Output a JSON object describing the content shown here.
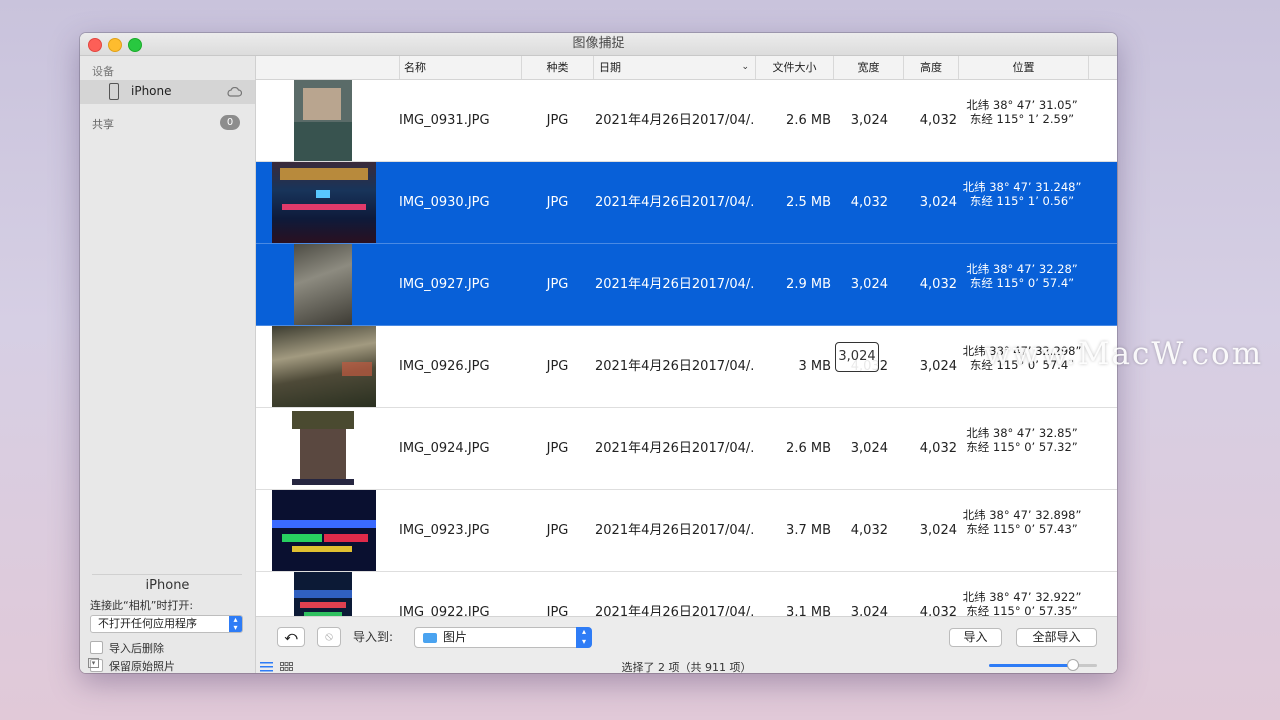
{
  "window": {
    "title": "图像捕捉"
  },
  "sidebar": {
    "devices_header": "设备",
    "device_name": "iPhone",
    "shared_header": "共享",
    "shared_count": "0",
    "device_section_title": "iPhone",
    "connect_label": "连接此“相机”时打开:",
    "open_app_value": "不打开任何应用程序",
    "delete_after_import": "导入后删除",
    "keep_originals": "保留原始照片"
  },
  "columns": {
    "name": "名称",
    "kind": "种类",
    "date": "日期",
    "size": "文件大小",
    "width": "宽度",
    "height": "高度",
    "location": "位置"
  },
  "rows": [
    {
      "name": "IMG_0931.JPG",
      "kind": "JPG",
      "date": "2021年4月26日2017/04/...",
      "size": "2.6 MB",
      "width": "3,024",
      "height": "4,032",
      "lat": "北纬 38° 47’ 31.05”",
      "lon": "东经 115° 1’ 2.59”",
      "selected": false
    },
    {
      "name": "IMG_0930.JPG",
      "kind": "JPG",
      "date": "2021年4月26日2017/04/...",
      "size": "2.5 MB",
      "width": "4,032",
      "height": "3,024",
      "lat": "北纬 38° 47’ 31.248”",
      "lon": "东经 115° 1’ 0.56”",
      "selected": true
    },
    {
      "name": "IMG_0927.JPG",
      "kind": "JPG",
      "date": "2021年4月26日2017/04/...",
      "size": "2.9 MB",
      "width": "3,024",
      "height": "4,032",
      "lat": "北纬 38° 47’ 32.28”",
      "lon": "东经 115° 0’ 57.4”",
      "selected": true
    },
    {
      "name": "IMG_0926.JPG",
      "kind": "JPG",
      "date": "2021年4月26日2017/04/...",
      "size": "3 MB",
      "width": "4,032",
      "height": "3,024",
      "lat": "北纬 38° 47’ 32.298”",
      "lon": "东经 115° 0’ 57.4”",
      "selected": false
    },
    {
      "name": "IMG_0924.JPG",
      "kind": "JPG",
      "date": "2021年4月26日2017/04/...",
      "size": "2.6 MB",
      "width": "3,024",
      "height": "4,032",
      "lat": "北纬 38° 47’ 32.85”",
      "lon": "东经 115° 0’ 57.32”",
      "selected": false
    },
    {
      "name": "IMG_0923.JPG",
      "kind": "JPG",
      "date": "2021年4月26日2017/04/...",
      "size": "3.7 MB",
      "width": "4,032",
      "height": "3,024",
      "lat": "北纬 38° 47’ 32.898”",
      "lon": "东经 115° 0’ 57.43”",
      "selected": false
    },
    {
      "name": "IMG_0922.JPG",
      "kind": "JPG",
      "date": "2021年4月26日2017/04/...",
      "size": "3.1 MB",
      "width": "3,024",
      "height": "4,032",
      "lat": "北纬 38° 47’ 32.922”",
      "lon": "东经 115° 0’ 57.35”",
      "selected": false
    }
  ],
  "footer": {
    "import_to_label": "导入到:",
    "destination": "图片",
    "import_button": "导入",
    "import_all_button": "全部导入",
    "status": "选择了 2 项（共 911 项）",
    "thumbnail_size": 0.78
  },
  "overlay": {
    "tooltip_value": "3,024",
    "watermark": "www.MacW.com"
  },
  "colors": {
    "selection": "#0860d8",
    "accent": "#2e7cf6"
  }
}
